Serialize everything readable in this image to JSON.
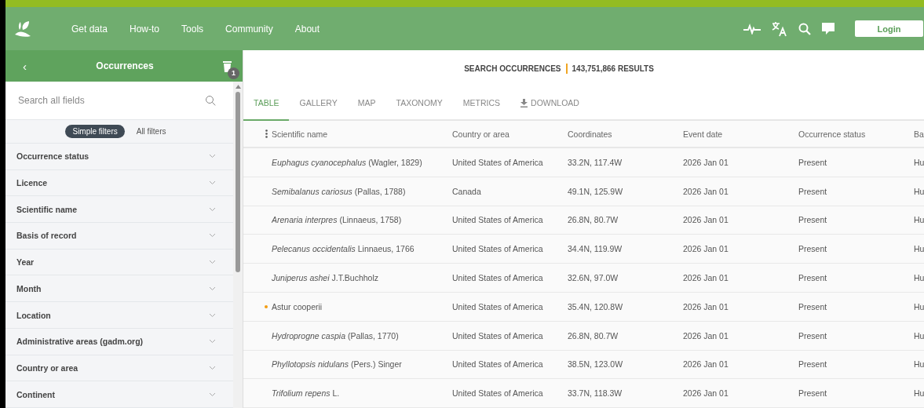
{
  "nav": {
    "links": [
      "Get data",
      "How-to",
      "Tools",
      "Community",
      "About"
    ],
    "login": "Login"
  },
  "sidebar": {
    "title": "Occurrences",
    "back": "‹",
    "badge": "1",
    "search": {
      "placeholder": "Search all fields"
    },
    "modes": [
      {
        "label": "Simple filters",
        "selected": true
      },
      {
        "label": "All filters",
        "selected": false
      }
    ],
    "filters": [
      {
        "label": "Occurrence status",
        "expanded": false
      },
      {
        "label": "Licence",
        "expanded": false
      },
      {
        "label": "Scientific name",
        "expanded": false
      },
      {
        "label": "Basis of record",
        "expanded": false
      },
      {
        "label": "Year",
        "expanded": false
      },
      {
        "label": "Month",
        "expanded": false
      },
      {
        "label": "Location",
        "expanded": false
      },
      {
        "label": "Administrative areas (gadm.org)",
        "expanded": false
      },
      {
        "label": "Country or area",
        "expanded": false
      },
      {
        "label": "Continent",
        "expanded": false
      }
    ]
  },
  "summary": {
    "title": "SEARCH OCCURRENCES",
    "results": "143,751,866 RESULTS"
  },
  "tabs": [
    {
      "label": "TABLE",
      "selected": true,
      "kind": "view"
    },
    {
      "label": "GALLERY",
      "selected": false,
      "kind": "view"
    },
    {
      "label": "MAP",
      "selected": false,
      "kind": "view"
    },
    {
      "label": "TAXONOMY",
      "selected": false,
      "kind": "view"
    },
    {
      "label": "METRICS",
      "selected": false,
      "kind": "view"
    },
    {
      "label": "DOWNLOAD",
      "selected": false,
      "kind": "download"
    }
  ],
  "table": {
    "columns": [
      "Scientific name",
      "Country or area",
      "Coordinates",
      "Event date",
      "Occurrence status",
      "Ba"
    ],
    "rows": [
      {
        "flagged": false,
        "cells": [
          "*Euphagus cyanocephalus* (Wagler, 1829)",
          "United States of America",
          "33.2N, 117.4W",
          "2026 Jan 01",
          "Present",
          "Hu"
        ]
      },
      {
        "flagged": false,
        "cells": [
          "*Semibalanus cariosus* (Pallas, 1788)",
          "Canada",
          "49.1N, 125.9W",
          "2026 Jan 01",
          "Present",
          "Hu"
        ]
      },
      {
        "flagged": false,
        "cells": [
          "*Arenaria interpres* (Linnaeus, 1758)",
          "United States of America",
          "26.8N, 80.7W",
          "2026 Jan 01",
          "Present",
          "Hu"
        ]
      },
      {
        "flagged": false,
        "cells": [
          "*Pelecanus occidentalis* Linnaeus, 1766",
          "United States of America",
          "34.4N, 119.9W",
          "2026 Jan 01",
          "Present",
          "Hu"
        ]
      },
      {
        "flagged": false,
        "cells": [
          "*Juniperus ashei* J.T.Buchholz",
          "United States of America",
          "32.6N, 97.0W",
          "2026 Jan 01",
          "Present",
          "Hu"
        ]
      },
      {
        "flagged": true,
        "cells": [
          "Astur cooperii",
          "United States of America",
          "35.4N, 120.8W",
          "2026 Jan 01",
          "Present",
          "Hu"
        ]
      },
      {
        "flagged": false,
        "cells": [
          "*Hydroprogne caspia* (Pallas, 1770)",
          "United States of America",
          "26.8N, 80.7W",
          "2026 Jan 01",
          "Present",
          "Hu"
        ]
      },
      {
        "flagged": false,
        "cells": [
          "*Phyllotopsis nidulans* (Pers.) Singer",
          "United States of America",
          "38.5N, 123.0W",
          "2026 Jan 01",
          "Present",
          "Hu"
        ]
      },
      {
        "flagged": false,
        "cells": [
          "*Trifolium repens* L.",
          "United States of America",
          "33.7N, 118.3W",
          "2026 Jan 01",
          "Present",
          "Hu"
        ]
      }
    ]
  }
}
